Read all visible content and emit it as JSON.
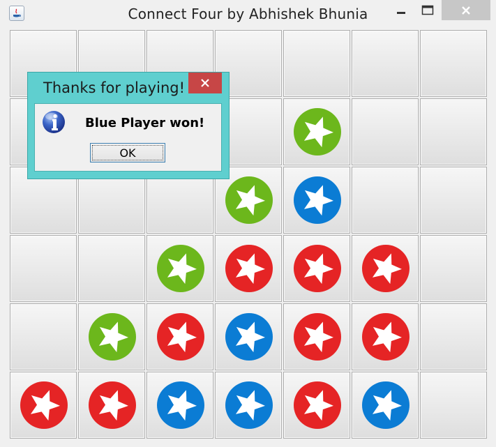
{
  "window": {
    "title": "Connect Four by Abhishek Bhunia"
  },
  "board": {
    "columns": 7,
    "rows": 6,
    "colors": {
      "red": "#e52425",
      "green": "#6cb71c",
      "blue": "#0b7cd4"
    },
    "cells": [
      [
        "empty",
        "empty",
        "empty",
        "empty",
        "empty",
        "empty",
        "empty"
      ],
      [
        "empty",
        "empty",
        "empty",
        "empty",
        "green",
        "empty",
        "empty"
      ],
      [
        "empty",
        "empty",
        "empty",
        "green",
        "blue",
        "empty",
        "empty"
      ],
      [
        "empty",
        "empty",
        "green",
        "red",
        "red",
        "red",
        "empty"
      ],
      [
        "empty",
        "green",
        "red",
        "blue",
        "red",
        "red",
        "empty"
      ],
      [
        "red",
        "red",
        "blue",
        "blue",
        "red",
        "blue",
        "empty"
      ]
    ]
  },
  "dialog": {
    "title": "Thanks for playing!",
    "message": "Blue Player won!",
    "ok_label": "OK",
    "icon": "info-icon"
  }
}
